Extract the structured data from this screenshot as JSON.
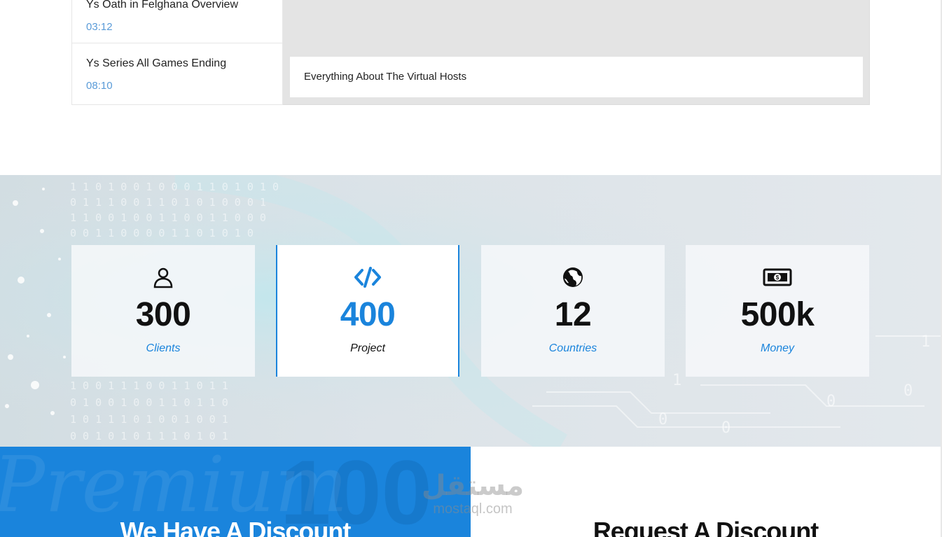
{
  "video_list": {
    "items": [
      {
        "title": "Ys Oath in Felghana Overview",
        "duration": "03:12"
      },
      {
        "title": "Ys Series All Games Ending",
        "duration": "08:10"
      }
    ]
  },
  "video_player": {
    "caption": "Everything About The Virtual Hosts"
  },
  "stats": [
    {
      "icon": "user-icon",
      "value": "300",
      "label": "Clients"
    },
    {
      "icon": "code-icon",
      "value": "400",
      "label": "Project"
    },
    {
      "icon": "globe-icon",
      "value": "12",
      "label": "Countries"
    },
    {
      "icon": "money-icon",
      "value": "500k",
      "label": "Money"
    }
  ],
  "discount": {
    "left_title": "We Have A Discount",
    "left_bg_text": "Premium",
    "left_bg_number": "100",
    "right_title": "Request A Discount"
  },
  "watermark": {
    "arabic": "مستقل",
    "latin": "mostaql.com"
  },
  "colors": {
    "accent": "#1a84dc",
    "time_text": "#5a9bd8"
  }
}
